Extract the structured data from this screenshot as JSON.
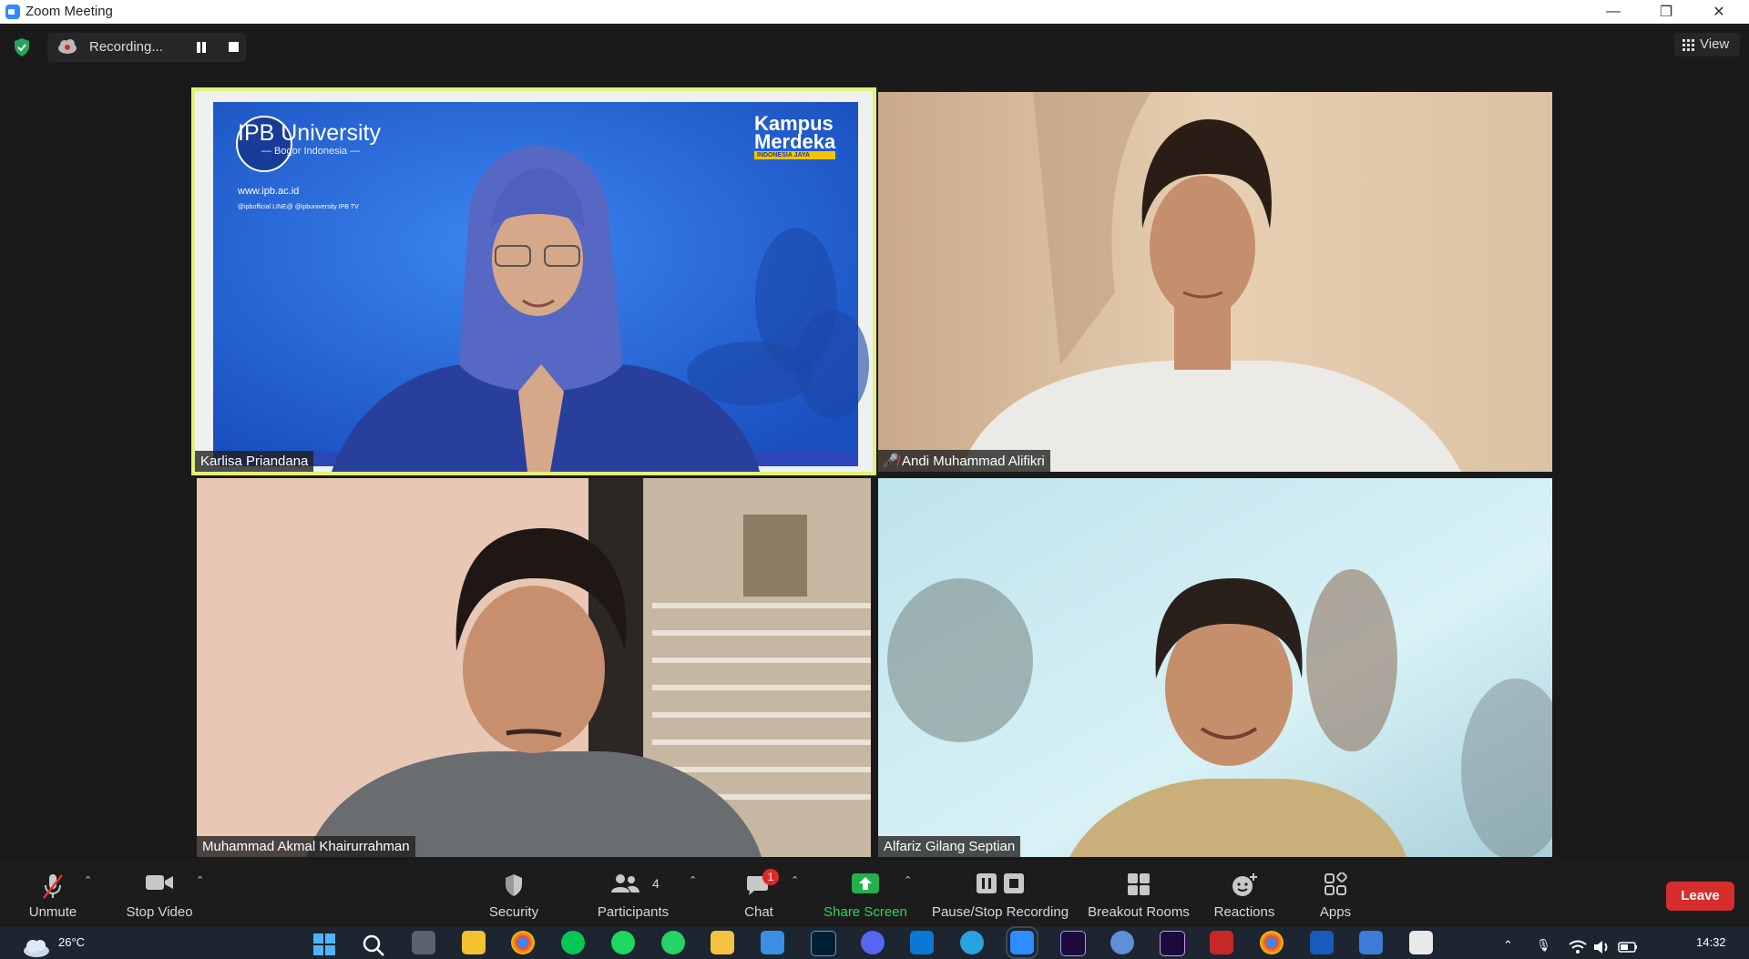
{
  "window": {
    "title": "Zoom Meeting",
    "minimize": "—",
    "restore": "❐",
    "close": "✕"
  },
  "recording": {
    "label": "Recording..."
  },
  "view": {
    "label": "View"
  },
  "participants_tiles": [
    {
      "name": "Karlisa Priandana",
      "muted": false,
      "active_speaker": true
    },
    {
      "name": "Andi Muhammad Alifikri",
      "muted": true,
      "active_speaker": false
    },
    {
      "name": "Muhammad Akmal Khairurrahman",
      "muted": false,
      "active_speaker": false
    },
    {
      "name": "Alfariz Gilang Septian",
      "muted": false,
      "active_speaker": false
    }
  ],
  "background": {
    "university": "IPB University",
    "subtitle": "— Bogor Indonesia —",
    "website": "www.ipb.ac.id",
    "socials": "@ipbofficial   LINE@ @ipbuniversity   IPB TV",
    "brand_line1": "Kampus",
    "brand_line2": "Merdeka",
    "brand_tag": "INDONESIA JAYA"
  },
  "toolbar": {
    "unmute": "Unmute",
    "stop_video": "Stop Video",
    "security": "Security",
    "participants": "Participants",
    "participants_count": "4",
    "chat": "Chat",
    "chat_badge": "1",
    "share_screen": "Share Screen",
    "pause_stop_recording": "Pause/Stop Recording",
    "breakout_rooms": "Breakout Rooms",
    "reactions": "Reactions",
    "apps": "Apps",
    "leave": "Leave"
  },
  "taskbar": {
    "weather_temp": "26°C",
    "clock_time": "14:32"
  },
  "colors": {
    "active_speaker_border": "#e3f07a",
    "share_green": "#22b14c",
    "leave_red": "#d62d2d",
    "chat_badge": "#e02828"
  }
}
